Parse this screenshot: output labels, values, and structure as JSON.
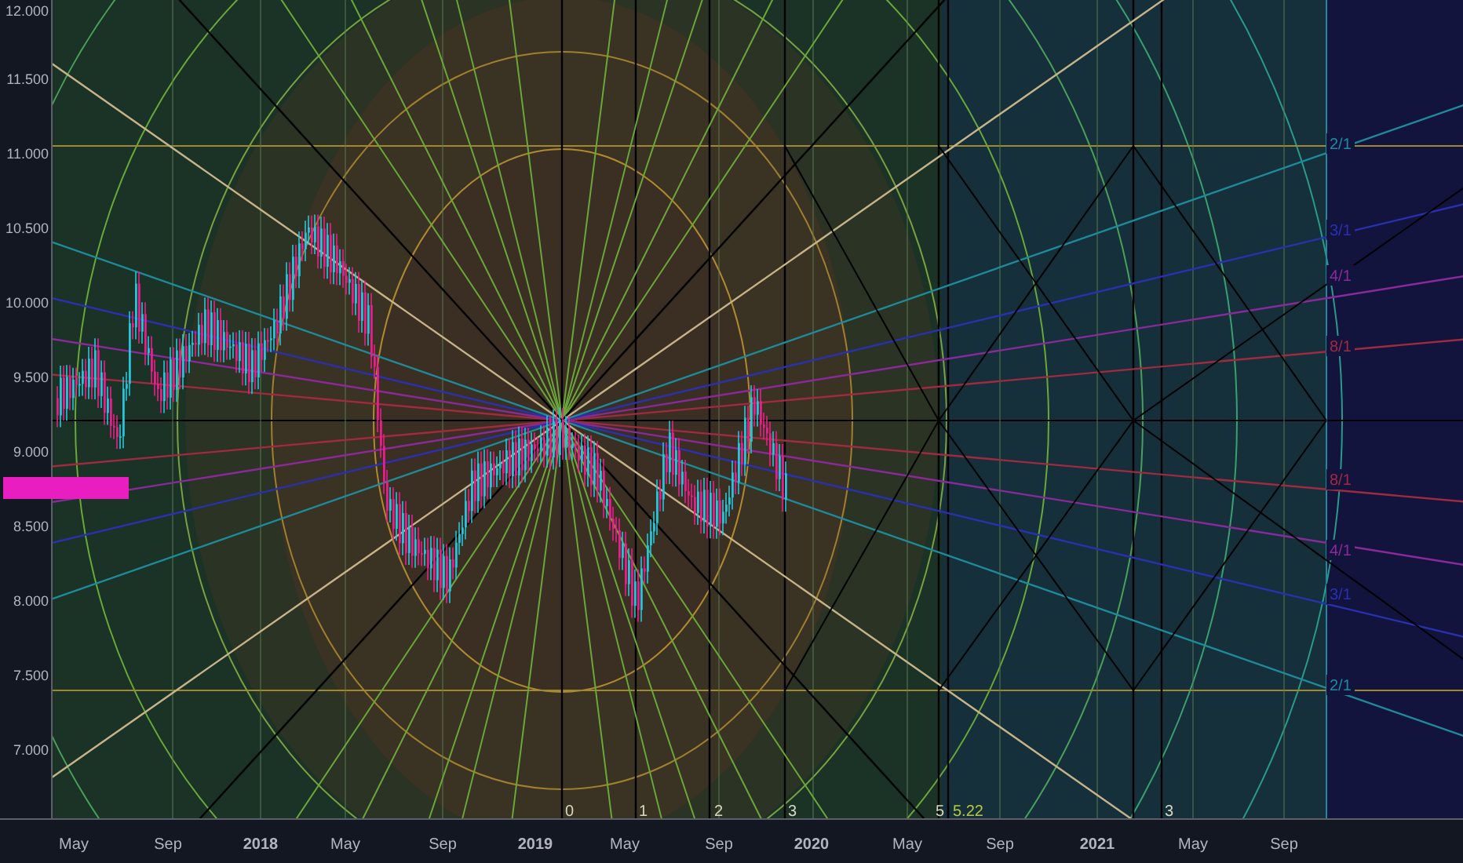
{
  "price_axis": {
    "labels": [
      "12.000",
      "11.500",
      "11.000",
      "10.500",
      "10.000",
      "9.500",
      "9.000",
      "8.500",
      "8.000",
      "7.500",
      "7.000"
    ]
  },
  "time_axis": {
    "labels": [
      "May",
      "Sep",
      "2018",
      "May",
      "Sep",
      "2019",
      "May",
      "Sep",
      "2020",
      "May",
      "Sep",
      "2021",
      "May",
      "Sep"
    ]
  },
  "cycle_labels": [
    "0",
    "1",
    "2",
    "3",
    "5",
    "5.22",
    "3"
  ],
  "ratio_labels": [
    {
      "text": "2/1",
      "color": "#1f8a9a"
    },
    {
      "text": "3/1",
      "color": "#2a30b0"
    },
    {
      "text": "4/1",
      "color": "#8a2a9a"
    },
    {
      "text": "8/1",
      "color": "#a02a40"
    },
    {
      "text": "8/1",
      "color": "#a02a40"
    },
    {
      "text": "4/1",
      "color": "#8a2a9a"
    },
    {
      "text": "3/1",
      "color": "#2a30b0"
    },
    {
      "text": "2/1",
      "color": "#1f8a9a"
    }
  ]
}
